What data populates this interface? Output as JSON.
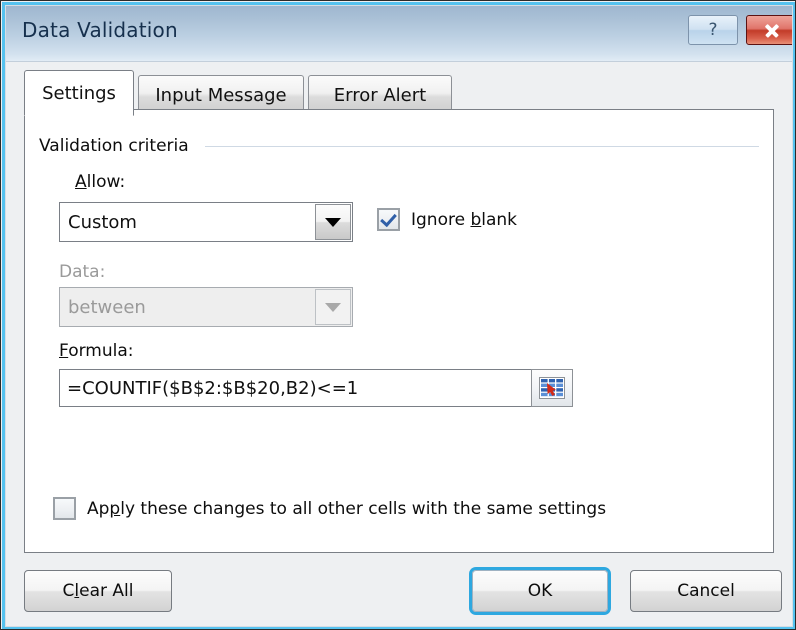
{
  "window": {
    "title": "Data Validation",
    "help_button": "?",
    "close_button": "close-icon",
    "accent_blue": "#55c2ef",
    "close_red": "#c23b28"
  },
  "tabs": [
    {
      "label": "Settings",
      "active": true
    },
    {
      "label": "Input Message",
      "active": false
    },
    {
      "label": "Error Alert",
      "active": false
    }
  ],
  "settings": {
    "group_title": "Validation criteria",
    "allow": {
      "label_prefix": "A",
      "label_rest": "llow:",
      "value": "Custom",
      "enabled": true
    },
    "ignore_blank": {
      "label_prefix": "Ignore ",
      "label_accel": "b",
      "label_rest": "lank",
      "checked": true
    },
    "data": {
      "label": "Data:",
      "value": "between",
      "enabled": false
    },
    "formula": {
      "label_prefix": "F",
      "label_rest": "ormula:",
      "value": "=COUNTIF($B$2:$B$20,B2)<=1",
      "placeholder": "",
      "range_picker_icon": "range-select-icon"
    },
    "apply_all": {
      "label_prefix": "Ap",
      "label_accel": "p",
      "label_rest": "ly these changes to all other cells with the same settings",
      "checked": false
    }
  },
  "footer": {
    "clear_all_prefix": "C",
    "clear_all_accel": "l",
    "clear_all_rest": "ear All",
    "ok": "OK",
    "cancel": "Cancel"
  }
}
